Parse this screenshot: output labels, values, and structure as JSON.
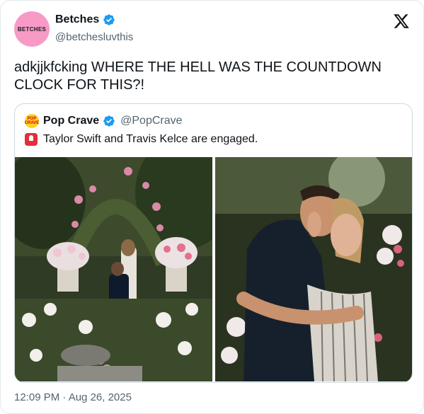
{
  "author": {
    "avatar_text": "BETCHES",
    "name": "Betches",
    "handle": "@betchesluvthis"
  },
  "tweet": {
    "text": "adkjjkfcking WHERE THE HELL WAS THE COUNTDOWN CLOCK FOR THIS?!",
    "timestamp": "12:09 PM · Aug 26, 2025"
  },
  "quoted": {
    "avatar_text": "POP CRAVE",
    "name": "Pop Crave",
    "handle": "@PopCrave",
    "text": "Taylor Swift and Travis Kelce are engaged."
  },
  "icons": {
    "verified": "verified-badge-icon",
    "x_logo": "x-logo-icon",
    "siren": "siren-emoji-icon"
  },
  "colors": {
    "verified_blue": "#1d9bf0",
    "text_primary": "#0f1419",
    "text_secondary": "#536471",
    "avatar_pink": "#f79ac6",
    "border": "#cfd9de"
  }
}
